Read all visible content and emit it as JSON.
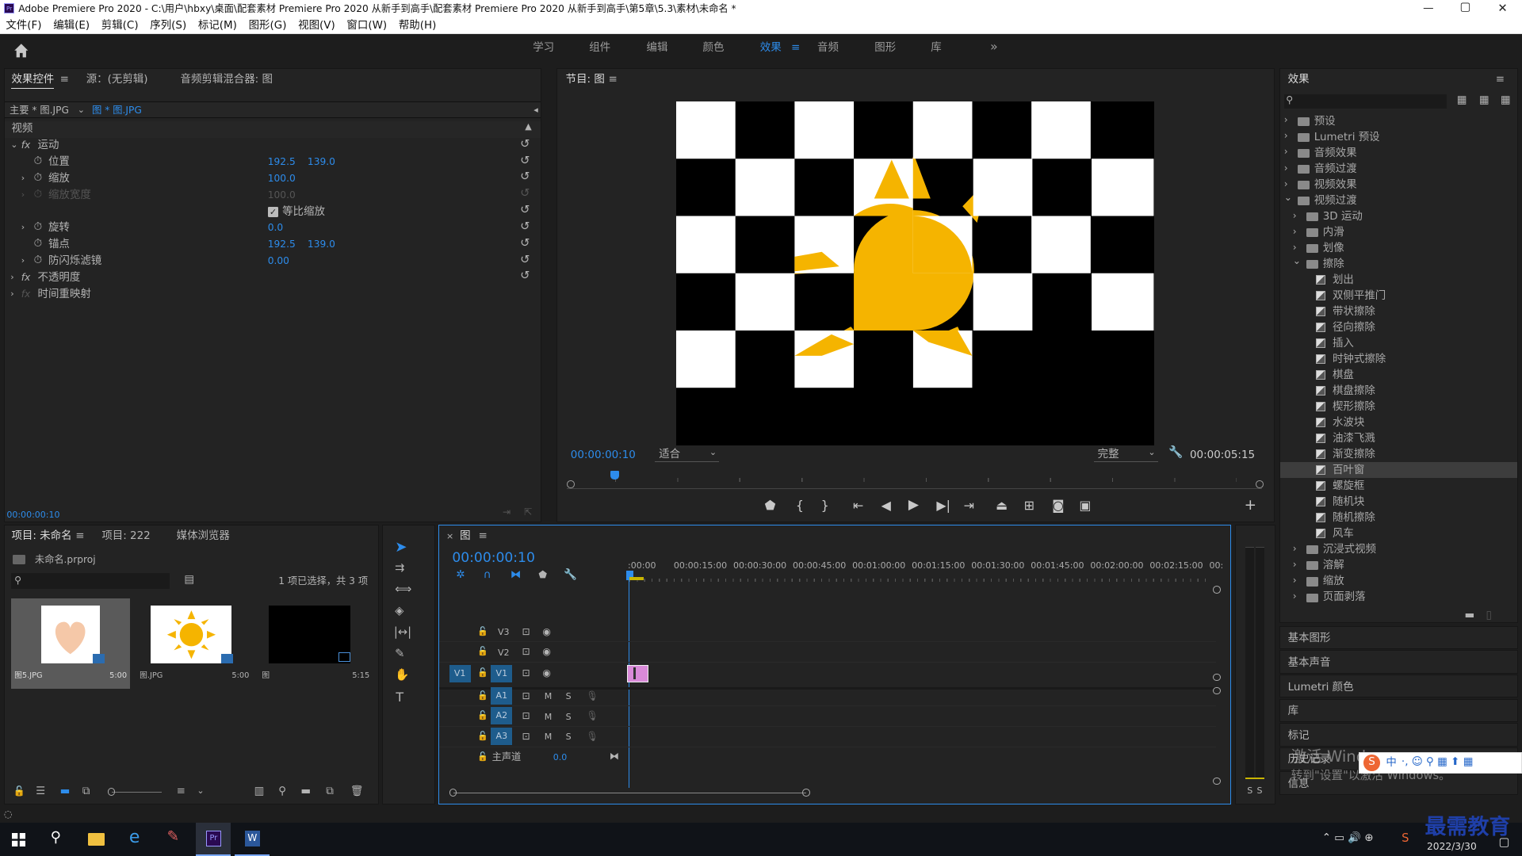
{
  "window": {
    "title": "Adobe Premiere Pro 2020 - C:\\用户\\hbxy\\桌面\\配套素材 Premiere Pro 2020 从新手到高手\\配套素材 Premiere Pro 2020 从新手到高手\\第5章\\5.3\\素材\\未命名 *",
    "controls": [
      "—",
      "▢",
      "✕"
    ]
  },
  "menu": [
    "文件(F)",
    "编辑(E)",
    "剪辑(C)",
    "序列(S)",
    "标记(M)",
    "图形(G)",
    "视图(V)",
    "窗口(W)",
    "帮助(H)"
  ],
  "workspaces": {
    "tabs": [
      "学习",
      "组件",
      "编辑",
      "颜色",
      "效果",
      "音频",
      "图形",
      "库"
    ],
    "active": "效果",
    "more": "»"
  },
  "effect_controls": {
    "tabs": [
      "效果控件",
      "源：(无剪辑)",
      "音频剪辑混合器: 图"
    ],
    "master": "主要 * 图.JPG",
    "clip": "图 * 图.JPG",
    "section": "视频",
    "motion": "运动",
    "position": {
      "label": "位置",
      "x": "192.5",
      "y": "139.0"
    },
    "scale": {
      "label": "缩放",
      "value": "100.0"
    },
    "scale_width": {
      "label": "缩放宽度",
      "value": "100.0"
    },
    "uniform": "等比缩放",
    "rotation": {
      "label": "旋转",
      "value": "0.0"
    },
    "anchor": {
      "label": "锚点",
      "x": "192.5",
      "y": "139.0"
    },
    "antiflicker": {
      "label": "防闪烁滤镜",
      "value": "0.00"
    },
    "opacity": "不透明度",
    "time_remap": "时间重映射",
    "fx": "fx",
    "timecode": "00:00:00:10"
  },
  "program": {
    "title": "节目: 图",
    "timecode": "00:00:00:10",
    "fit": "适合",
    "quality": "完整",
    "duration": "00:00:05:15"
  },
  "effects_panel": {
    "title": "效果",
    "tree": [
      {
        "label": "预设",
        "type": "folder",
        "level": 0
      },
      {
        "label": "Lumetri 预设",
        "type": "folder",
        "level": 0
      },
      {
        "label": "音频效果",
        "type": "folder",
        "level": 0
      },
      {
        "label": "音频过渡",
        "type": "folder",
        "level": 0
      },
      {
        "label": "视频效果",
        "type": "folder",
        "level": 0
      },
      {
        "label": "视频过渡",
        "type": "folder",
        "level": 0,
        "open": true
      },
      {
        "label": "3D 运动",
        "type": "folder",
        "level": 1
      },
      {
        "label": "内滑",
        "type": "folder",
        "level": 1
      },
      {
        "label": "划像",
        "type": "folder",
        "level": 1
      },
      {
        "label": "擦除",
        "type": "folder",
        "level": 1,
        "open": true
      },
      {
        "label": "划出",
        "type": "item",
        "level": 2
      },
      {
        "label": "双侧平推门",
        "type": "item",
        "level": 2
      },
      {
        "label": "带状擦除",
        "type": "item",
        "level": 2
      },
      {
        "label": "径向擦除",
        "type": "item",
        "level": 2
      },
      {
        "label": "插入",
        "type": "item",
        "level": 2
      },
      {
        "label": "时钟式擦除",
        "type": "item",
        "level": 2
      },
      {
        "label": "棋盘",
        "type": "item",
        "level": 2
      },
      {
        "label": "棋盘擦除",
        "type": "item",
        "level": 2
      },
      {
        "label": "楔形擦除",
        "type": "item",
        "level": 2
      },
      {
        "label": "水波块",
        "type": "item",
        "level": 2
      },
      {
        "label": "油漆飞溅",
        "type": "item",
        "level": 2
      },
      {
        "label": "渐变擦除",
        "type": "item",
        "level": 2
      },
      {
        "label": "百叶窗",
        "type": "item",
        "level": 2,
        "selected": true
      },
      {
        "label": "螺旋框",
        "type": "item",
        "level": 2
      },
      {
        "label": "随机块",
        "type": "item",
        "level": 2
      },
      {
        "label": "随机擦除",
        "type": "item",
        "level": 2
      },
      {
        "label": "风车",
        "type": "item",
        "level": 2
      },
      {
        "label": "沉浸式视频",
        "type": "folder",
        "level": 1
      },
      {
        "label": "溶解",
        "type": "folder",
        "level": 1
      },
      {
        "label": "缩放",
        "type": "folder",
        "level": 1
      },
      {
        "label": "页面剥落",
        "type": "folder",
        "level": 1
      }
    ],
    "sections": [
      "基本图形",
      "基本声音",
      "Lumetri 颜色",
      "库",
      "标记",
      "历史记录",
      "信息"
    ]
  },
  "project": {
    "tabs": [
      "项目: 未命名",
      "项目: 222",
      "媒体浏览器"
    ],
    "file": "未命名.prproj",
    "selection": "1 项已选择，共 3 项",
    "items": [
      {
        "name": "图5.JPG",
        "duration": "5:00"
      },
      {
        "name": "图.JPG",
        "duration": "5:00"
      },
      {
        "name": "图",
        "duration": "5:15"
      }
    ]
  },
  "timeline": {
    "tab": "图",
    "timecode": "00:00:00:10",
    "ruler": [
      ":00:00",
      "00:00:15:00",
      "00:00:30:00",
      "00:00:45:00",
      "00:01:00:00",
      "00:01:15:00",
      "00:01:30:00",
      "00:01:45:00",
      "00:02:00:00",
      "00:02:15:00",
      "00:"
    ],
    "video_tracks": [
      "V3",
      "V2",
      "V1"
    ],
    "audio_tracks": [
      "A1",
      "A2",
      "A3"
    ],
    "source_patch_video": "V1",
    "master": {
      "label": "主声道",
      "value": "0.0"
    },
    "ms": {
      "m": "M",
      "s": "S"
    }
  },
  "meter": {
    "labels": [
      "S",
      "S"
    ]
  },
  "watermark": {
    "line1": "激活 Windows",
    "line2": "转到\"设置\"以激活 Windows。"
  },
  "taskbar": {
    "date": "2022/3/30",
    "logo": "最需教育",
    "ime": "中"
  },
  "colors": {
    "accent": "#2d8ceb",
    "sun": "#f5b400",
    "clip": "#d98ad8",
    "selected_row": "#3d3d3d"
  }
}
